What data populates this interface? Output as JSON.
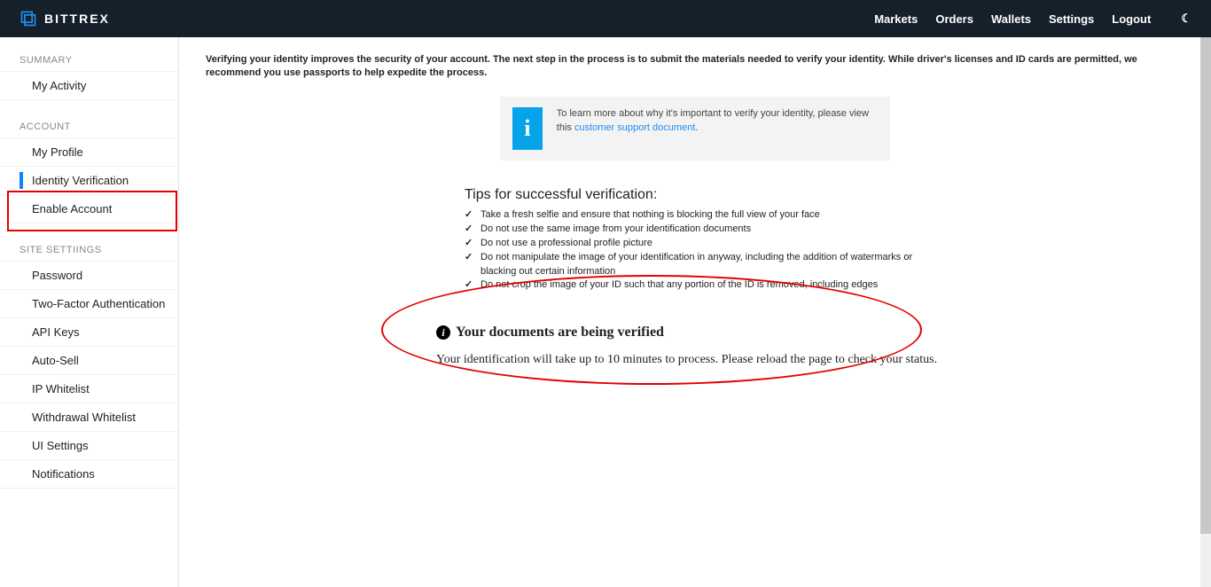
{
  "header": {
    "brand": "BITTREX",
    "nav": [
      "Markets",
      "Orders",
      "Wallets",
      "Settings",
      "Logout"
    ]
  },
  "sidebar": {
    "sections": [
      {
        "title": "SUMMARY",
        "items": [
          "My Activity"
        ]
      },
      {
        "title": "ACCOUNT",
        "items": [
          "My Profile",
          "Identity Verification",
          "Enable Account"
        ]
      },
      {
        "title": "SITE SETTIINGS",
        "items": [
          "Password",
          "Two-Factor Authentication",
          "API Keys",
          "Auto-Sell",
          "IP Whitelist",
          "Withdrawal Whitelist",
          "UI Settings",
          "Notifications"
        ]
      }
    ],
    "active": "Identity Verification"
  },
  "content": {
    "intro": "Verifying your identity improves the security of your account. The next step in the process is to submit the materials needed to verify your identity. While driver's licenses and ID cards are permitted, we recommend you use passports to help expedite the process.",
    "info_prefix": "To learn more about why it's important to verify your identity, please view this ",
    "info_link": "customer support document",
    "info_suffix": ".",
    "tips_title": "Tips for successful verification:",
    "tips": [
      "Take a fresh selfie and ensure that nothing is blocking the full view of your face",
      "Do not use the same image from your identification documents",
      "Do not use a professional profile picture",
      "Do not manipulate the image of your identification in anyway, including the addition of watermarks or blacking out certain information",
      "Do not crop the image of your ID such that any portion of the ID is removed, including edges"
    ],
    "status_title": "Your documents are being verified",
    "status_text": "Your identification will take up to 10 minutes to process. Please reload the page to check your status."
  }
}
